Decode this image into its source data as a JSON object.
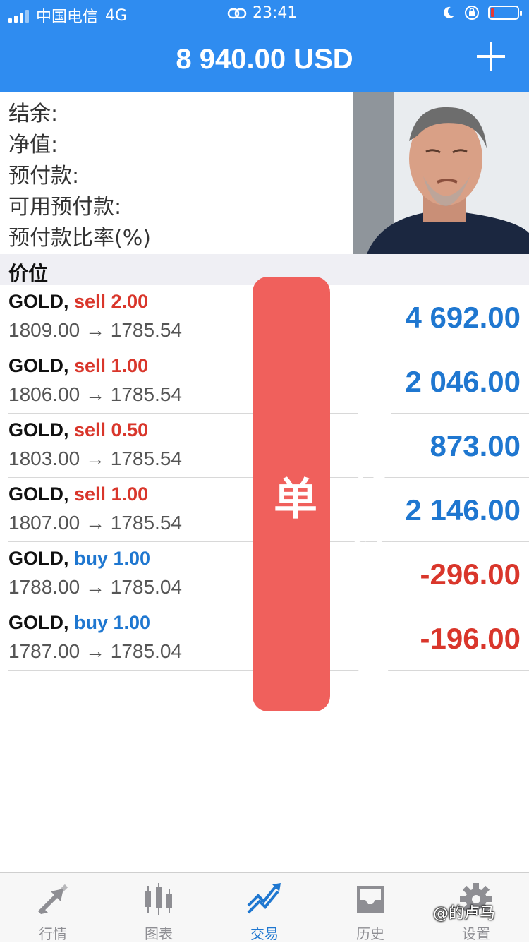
{
  "status_bar": {
    "carrier": "中国电信",
    "network": "4G",
    "time": "23:41"
  },
  "header": {
    "title": "8 940.00 USD",
    "add_icon": "plus-icon"
  },
  "summary": {
    "labels": [
      "结余:",
      "净值:",
      "预付款:",
      "可用预付款:",
      "预付款比率(%)"
    ]
  },
  "positions_section": {
    "title": "价位"
  },
  "positions": [
    {
      "symbol": "GOLD,",
      "side": "sell 2.00",
      "type": "sell",
      "prices": "1809.00 → 1785.54",
      "profit": "4 692.00"
    },
    {
      "symbol": "GOLD,",
      "side": "sell 1.00",
      "type": "sell",
      "prices": "1806.00 → 1785.54",
      "profit": "2 046.00"
    },
    {
      "symbol": "GOLD,",
      "side": "sell 0.50",
      "type": "sell",
      "prices": "1803.00 → 1785.54",
      "profit": "873.00"
    },
    {
      "symbol": "GOLD,",
      "side": "sell 1.00",
      "type": "sell",
      "prices": "1807.00 → 1785.54",
      "profit": "2 146.00"
    },
    {
      "symbol": "GOLD,",
      "side": "buy 1.00",
      "type": "buy",
      "prices": "1788.00 → 1785.04",
      "profit": "-296.00"
    },
    {
      "symbol": "GOLD,",
      "side": "buy 1.00",
      "type": "buy",
      "prices": "1787.00 → 1785.04",
      "profit": "-196.00"
    }
  ],
  "overlay_caption": "牛不牛这操作这空单",
  "tabs": [
    {
      "label": "行情",
      "icon": "quotes-arrows-icon"
    },
    {
      "label": "图表",
      "icon": "candlestick-chart-icon"
    },
    {
      "label": "交易",
      "icon": "trade-trend-icon",
      "active": true
    },
    {
      "label": "历史",
      "icon": "history-inbox-icon"
    },
    {
      "label": "设置",
      "icon": "gear-icon"
    }
  ],
  "watermark": "@的卢马",
  "colors": {
    "brand_blue": "#2f8cf0",
    "profit_blue": "#1f77d0",
    "loss_red": "#d9362b",
    "overlay_red": "#f0605c"
  }
}
